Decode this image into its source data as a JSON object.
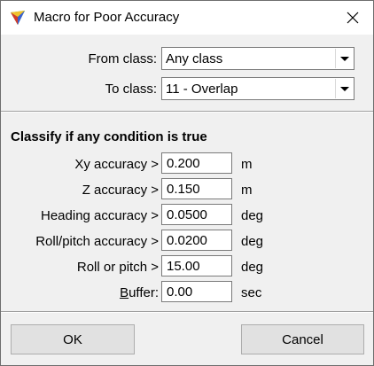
{
  "window": {
    "title": "Macro for Poor Accuracy",
    "close_icon": "close-icon",
    "app_icon": "terrasolid-triangle-icon"
  },
  "classes": {
    "from_label": "From class:",
    "from_value": "Any class",
    "to_label": "To class:",
    "to_value": "11 - Overlap"
  },
  "conditions": {
    "heading": "Classify if any condition is true",
    "xy": {
      "label": "Xy accuracy >",
      "value": "0.200",
      "unit": "m"
    },
    "z": {
      "label": "Z accuracy >",
      "value": "0.150",
      "unit": "m"
    },
    "heading_acc": {
      "label": "Heading accuracy >",
      "value": "0.0500",
      "unit": "deg"
    },
    "rollpitch": {
      "label": "Roll/pitch accuracy >",
      "value": "0.0200",
      "unit": "deg"
    },
    "roll_or_pitch": {
      "label": "Roll or pitch >",
      "value": "15.00",
      "unit": "deg"
    },
    "buffer": {
      "label_first": "B",
      "label_rest": "uffer:",
      "value": "0.00",
      "unit": "sec"
    }
  },
  "buttons": {
    "ok": "OK",
    "cancel": "Cancel"
  }
}
